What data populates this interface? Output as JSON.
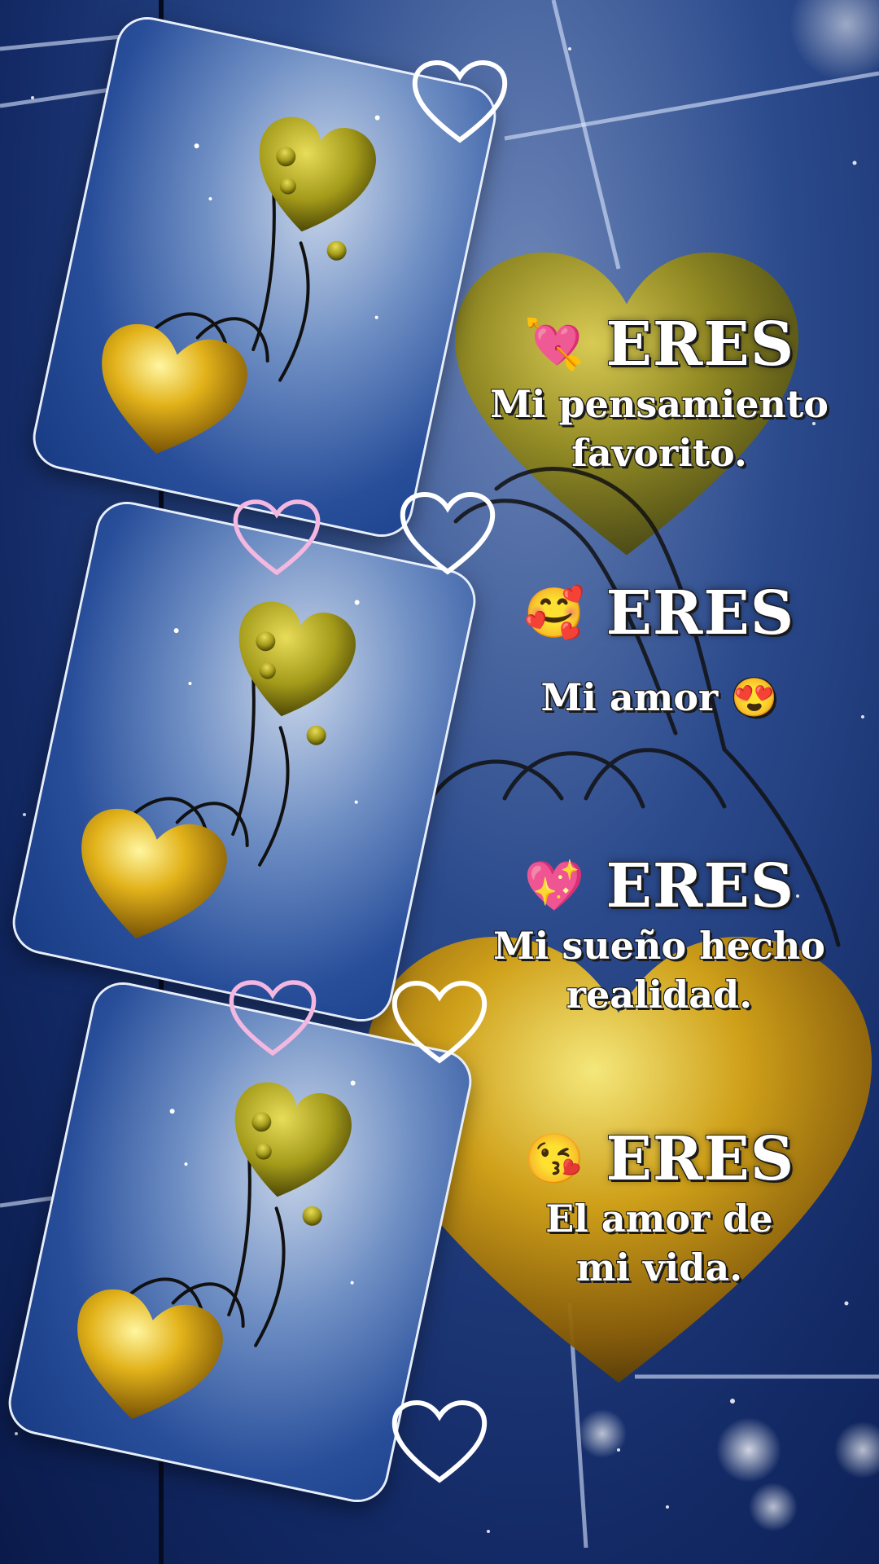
{
  "messages": [
    {
      "emoji": "💘",
      "heading": "ERES",
      "line1": "Mi pensamiento",
      "line2": "favorito."
    },
    {
      "emoji": "🥰",
      "heading": "ERES",
      "line1": "Mi amor 😍",
      "line2": ""
    },
    {
      "emoji": "💖",
      "heading": "ERES",
      "line1": "Mi sueño hecho",
      "line2": "realidad."
    },
    {
      "emoji": "😘",
      "heading": "ERES",
      "line1": "El amor de",
      "line2": "mi vida."
    }
  ],
  "colors": {
    "background_dark": "#0a1a4a",
    "background_light": "#6d86b8",
    "gold": "#d4a514",
    "gold_dark": "#8a6a08",
    "text": "#ffffff"
  },
  "icons": [
    "gold-heart-icon",
    "outline-heart-icon",
    "finger-heart-hand-icon",
    "star-sparkle-icon"
  ]
}
